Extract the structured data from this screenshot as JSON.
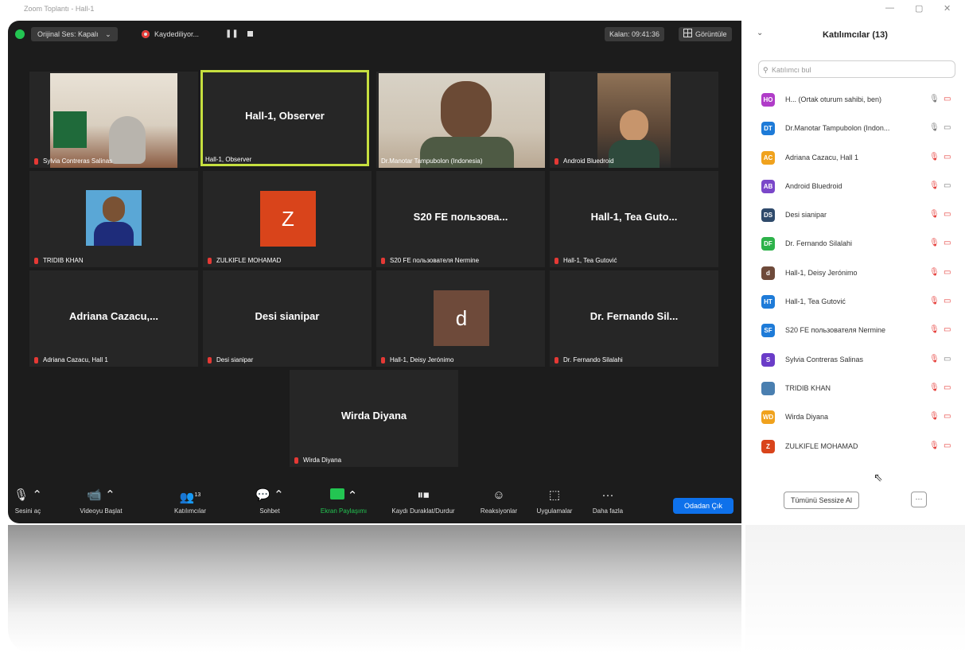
{
  "window": {
    "title": "Zoom Toplantı - Hall-1",
    "controls": {
      "minimize": "—",
      "maximize": "▢",
      "close": "✕"
    }
  },
  "topbar": {
    "original_sound": "Orijinal Ses: Kapalı",
    "original_sound_chevron": "⌄",
    "recording": "Kaydediliyor...",
    "pause_symbol": "❚❚",
    "time": "Kalan: 09:41:36",
    "view": "Görüntüle"
  },
  "tiles": [
    {
      "label": "Sylvia Contreras Salinas",
      "type": "video"
    },
    {
      "label": "Hall-1, Observer",
      "big": "Hall-1, Observer",
      "type": "name",
      "active": true,
      "muted": false
    },
    {
      "label": "Dr.Manotar Tampubolon (Indonesia)",
      "type": "video",
      "muted": false
    },
    {
      "label": "Android Bluedroid",
      "type": "video"
    },
    {
      "label": "TRIDIB KHAN",
      "type": "photo"
    },
    {
      "label": "ZULKIFLE MOHAMAD",
      "type": "avatar",
      "avatar_letter": "Z",
      "avatar_color": "#d9441b"
    },
    {
      "label": "S20 FE пользователя Nermine",
      "big": "S20 FE пользова...",
      "type": "name"
    },
    {
      "label": "Hall-1, Tea Gutović",
      "big": "Hall-1, Tea Guto...",
      "type": "name"
    },
    {
      "label": "Adriana Cazacu, Hall 1",
      "big": "Adriana Cazacu,...",
      "type": "name"
    },
    {
      "label": "Desi sianipar",
      "big": "Desi sianipar",
      "type": "name"
    },
    {
      "label": "Hall-1, Deisy Jerónimo",
      "type": "avatar",
      "avatar_letter": "d",
      "avatar_color": "#6e4a3a"
    },
    {
      "label": "Dr. Fernando Silalahi",
      "big": "Dr. Fernando Sil...",
      "type": "name"
    },
    {
      "label": "Wirda Diyana",
      "big": "Wirda Diyana",
      "type": "name"
    }
  ],
  "toolbar": {
    "mute": "Sesini aç",
    "video": "Videoyu Başlat",
    "participants": "Katılımcılar",
    "participants_count": "13",
    "chat": "Sohbet",
    "share": "Ekran Paylaşımı",
    "record": "Kaydı Duraklat/Durdur",
    "reactions": "Reaksiyonlar",
    "apps": "Uygulamalar",
    "more": "Daha fazla",
    "leave": "Odadan Çık"
  },
  "panel": {
    "title": "Katılımcılar (13)",
    "collapse_icon": "⌄",
    "search_placeholder": "Katılımcı bul",
    "participants": [
      {
        "initials": "HO",
        "color": "#b03cc8",
        "name": "H... (Ortak oturum sahibi, ben)",
        "mic": "on",
        "cam": "off"
      },
      {
        "initials": "DT",
        "color": "#1e7bd8",
        "name": "Dr.Manotar Tampubolon (Indon...",
        "mic": "on",
        "cam": "on"
      },
      {
        "initials": "AC",
        "color": "#f0a21d",
        "name": "Adriana Cazacu, Hall 1",
        "mic": "off",
        "cam": "off"
      },
      {
        "initials": "AB",
        "color": "#7a47c9",
        "name": "Android Bluedroid",
        "mic": "off",
        "cam": "on"
      },
      {
        "initials": "DS",
        "color": "#2f4a6b",
        "name": "Desi sianipar",
        "mic": "off",
        "cam": "off"
      },
      {
        "initials": "DF",
        "color": "#2db24a",
        "name": "Dr. Fernando Silalahi",
        "mic": "off",
        "cam": "off"
      },
      {
        "initials": "d",
        "color": "#6e4a3a",
        "name": "Hall-1, Deisy Jerónimo",
        "mic": "off",
        "cam": "off"
      },
      {
        "initials": "HT",
        "color": "#1e7bd8",
        "name": "Hall-1, Tea Gutović",
        "mic": "off",
        "cam": "off"
      },
      {
        "initials": "SF",
        "color": "#1e7bd8",
        "name": "S20 FE пользователя Nermine",
        "mic": "off",
        "cam": "off"
      },
      {
        "initials": "S",
        "color": "#6a3cc8",
        "name": "Sylvia Contreras Salinas",
        "mic": "off",
        "cam": "on"
      },
      {
        "initials": "",
        "color": "#4a7fb0",
        "name": "TRIDIB KHAN",
        "mic": "off",
        "cam": "off"
      },
      {
        "initials": "WD",
        "color": "#f0a21d",
        "name": "Wirda Diyana",
        "mic": "off",
        "cam": "off"
      },
      {
        "initials": "Z",
        "color": "#d9441b",
        "name": "ZULKIFLE MOHAMAD",
        "mic": "off",
        "cam": "off"
      }
    ],
    "mute_all": "Tümünü Sessize Al",
    "more": "···"
  }
}
